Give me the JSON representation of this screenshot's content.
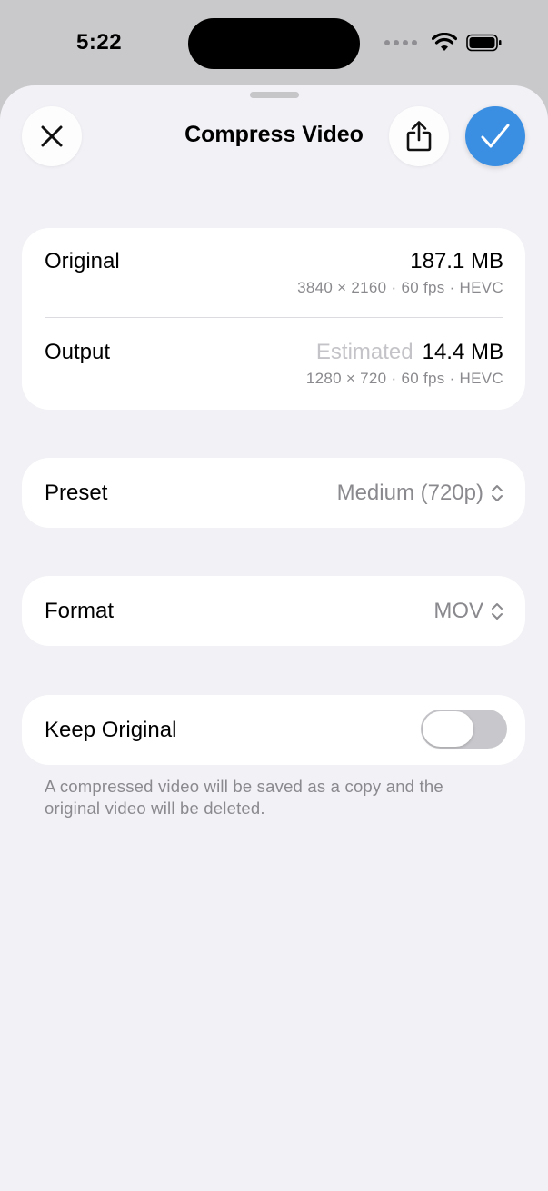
{
  "status_bar": {
    "time": "5:22"
  },
  "header": {
    "title": "Compress Video",
    "close_icon": "xmark-icon",
    "share_icon": "share-icon",
    "confirm_icon": "checkmark-icon",
    "accent_color": "#3b8fe3"
  },
  "info": {
    "original": {
      "label": "Original",
      "size": "187.1 MB",
      "details": "3840 × 2160 · 60 fps · HEVC"
    },
    "output": {
      "label": "Output",
      "estimated_label": "Estimated",
      "size": "14.4 MB",
      "details": "1280 × 720 · 60 fps · HEVC"
    }
  },
  "preset": {
    "label": "Preset",
    "value": "Medium (720p)"
  },
  "format": {
    "label": "Format",
    "value": "MOV"
  },
  "keep_original": {
    "label": "Keep Original",
    "enabled": false,
    "footnote": "A compressed video will be saved as a copy and the original video will be deleted."
  }
}
